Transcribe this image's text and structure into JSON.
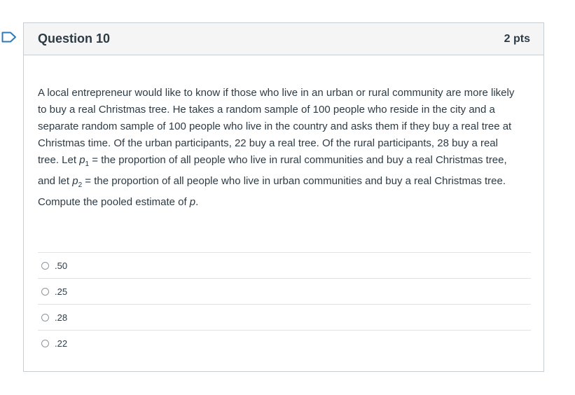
{
  "question": {
    "title": "Question 10",
    "points": "2 pts",
    "text_before_p1": "A local entrepreneur would like to know if those who live in an urban or rural community are more likely to buy a real Christmas tree. He takes a random sample of 100 people who reside in the city and a separate random sample of 100 people who live in the country and asks them if they buy a real tree at Christmas time. Of the urban participants, 22 buy a real tree. Of the rural participants, 28 buy a real tree. Let ",
    "p1_symbol": "p",
    "p1_subscript": "1",
    "text_after_p1": " = the proportion of all people who live in rural communities and buy a real Christmas tree, and let ",
    "p2_symbol": "p",
    "p2_subscript": "2",
    "text_after_p2": " = the proportion of all people who live in urban communities and buy a real Christmas tree. Compute the pooled estimate of ",
    "final_symbol": "p",
    "final_punct": "."
  },
  "answers": [
    {
      "label": ".50"
    },
    {
      "label": ".25"
    },
    {
      "label": ".28"
    },
    {
      "label": ".22"
    }
  ],
  "icons": {
    "flag": "bookmark-flag-icon",
    "radio": "radio-button-icon"
  },
  "colors": {
    "flag": "#2b7abc",
    "header_bg": "#f5f5f5",
    "border": "#c7cdd1",
    "text": "#2d3b45"
  }
}
